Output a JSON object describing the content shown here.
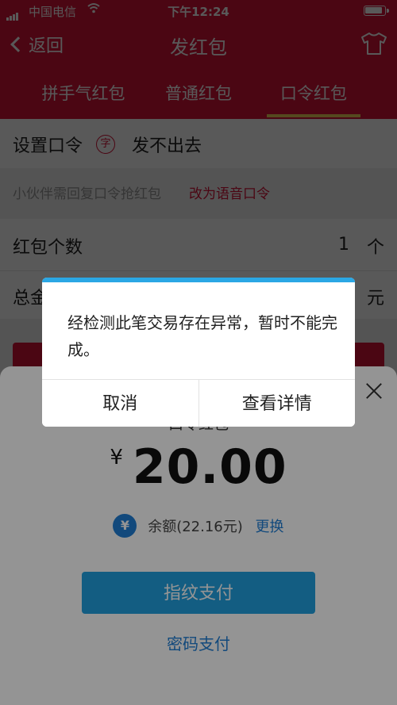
{
  "status_bar": {
    "carrier": "中国电信",
    "time": "下午12:24"
  },
  "nav": {
    "back_label": "返回",
    "title": "发红包"
  },
  "tabs": [
    {
      "label": "拼手气红包",
      "active": false
    },
    {
      "label": "普通红包",
      "active": false
    },
    {
      "label": "口令红包",
      "active": true
    }
  ],
  "form": {
    "password_label": "设置口令",
    "password_char_icon": "字",
    "password_value": "发不出去",
    "hint_text": "小伙伴需回复口令抢红包",
    "switch_voice": "改为语音口令",
    "count_label": "红包个数",
    "count_value": "1",
    "count_unit": "个",
    "total_label": "总金",
    "total_unit": "元"
  },
  "payment_sheet": {
    "title": "口令红包",
    "currency": "¥",
    "amount": "20.00",
    "coin_symbol": "¥",
    "balance_text": "余额(22.16元)",
    "change_label": "更换",
    "pay_button": "指纹支付",
    "password_pay": "密码支付"
  },
  "dialog": {
    "message": "经检测此笔交易存在异常，暂时不能完成。",
    "cancel_label": "取消",
    "details_label": "查看详情"
  },
  "colors": {
    "brand_red": "#d8153a",
    "accent_blue": "#22a1e0",
    "tab_underline": "#f6d35a"
  }
}
